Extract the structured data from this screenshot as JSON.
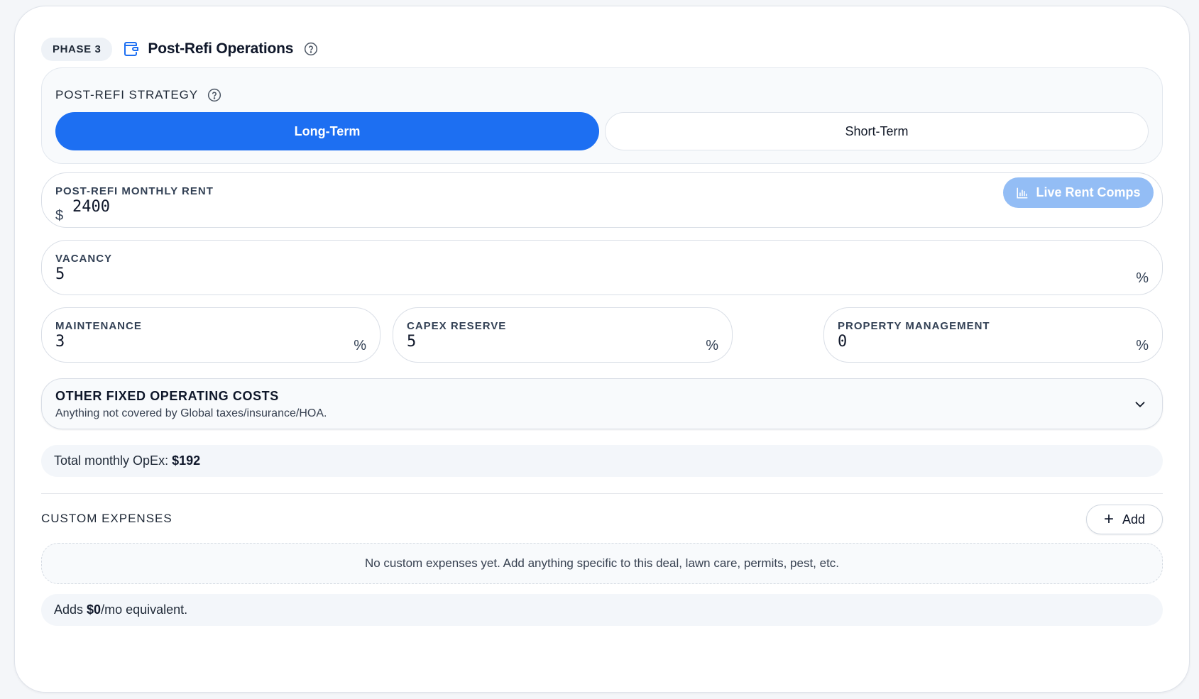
{
  "header": {
    "phase_badge": "PHASE 3",
    "title": "Post-Refi Operations",
    "title_icon": "wallet-icon",
    "help_icon": "help-circle-icon"
  },
  "strategy": {
    "label": "POST-REFI STRATEGY",
    "options": [
      {
        "label": "Long-Term",
        "selected": true
      },
      {
        "label": "Short-Term",
        "selected": false
      }
    ]
  },
  "rent": {
    "label": "POST-REFI MONTHLY RENT",
    "prefix": "$",
    "value": "2400",
    "live_comps_label": "Live Rent Comps",
    "live_comps_icon": "bar-chart-icon"
  },
  "vacancy": {
    "label": "VACANCY",
    "value": "5",
    "suffix": "%"
  },
  "maintenance": {
    "label": "MAINTENANCE",
    "value": "3",
    "suffix": "%"
  },
  "capex": {
    "label": "CAPEX RESERVE",
    "value": "5",
    "suffix": "%"
  },
  "management": {
    "label": "PROPERTY MANAGEMENT",
    "value": "0",
    "suffix": "%"
  },
  "other_costs": {
    "title": "OTHER FIXED OPERATING COSTS",
    "subtitle": "Anything not covered by Global taxes/insurance/HOA.",
    "expanded": false
  },
  "opex_summary": {
    "label": "Total monthly OpEx:",
    "value": "$192"
  },
  "custom_expenses": {
    "label": "CUSTOM EXPENSES",
    "add_label": "Add",
    "empty_text": "No custom expenses yet. Add anything specific to this deal, lawn care, permits, pest, etc.",
    "adds_prefix": "Adds",
    "adds_value": "$0",
    "adds_suffix": "/mo equivalent."
  },
  "colors": {
    "accent": "#1d6ff2",
    "accent_light": "#93bdf5",
    "panel": "#f8fafc"
  }
}
